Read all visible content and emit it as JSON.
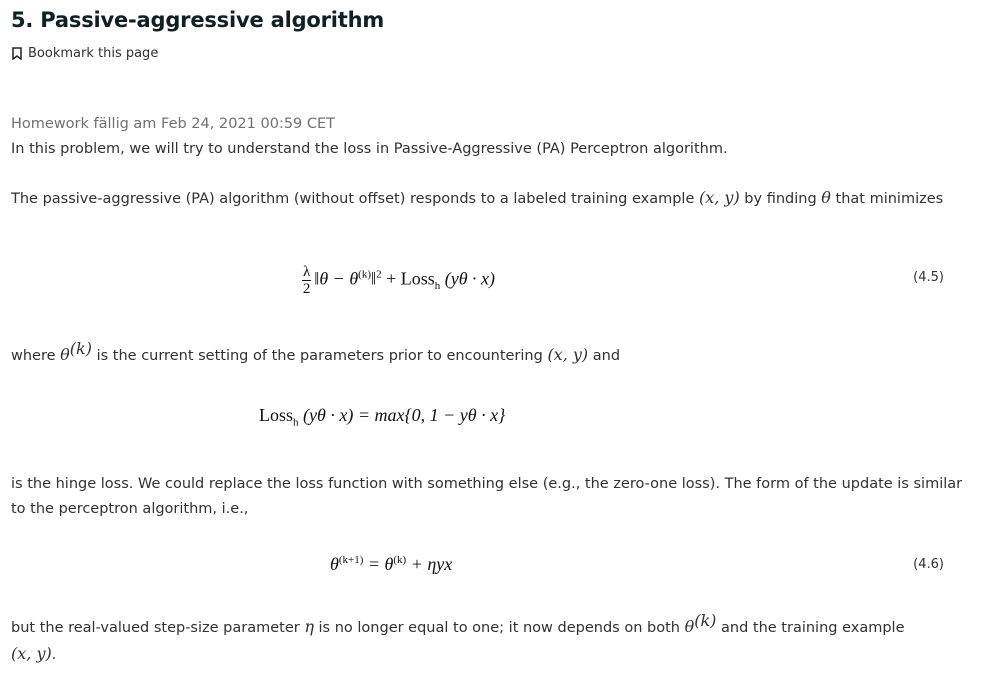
{
  "title": "5. Passive-aggressive algorithm",
  "bookmark": {
    "label": "Bookmark this page",
    "icon": "bookmark-icon"
  },
  "due": "Homework fällig am Feb 24, 2021 00:59 CET",
  "intro": "In this problem, we will try to understand the loss in Passive-Aggressive (PA) Perceptron algorithm.",
  "para1": {
    "a": "The passive-aggressive (PA) algorithm (without offset) responds to a labeled training example ",
    "xy": "(x, y)",
    "b": " by finding ",
    "theta": "θ",
    "c": " that minimizes"
  },
  "eq1": {
    "frac_num": "λ",
    "frac_den": "2",
    "body": "‖θ − θ",
    "sup_k": "(k)",
    "close": "‖",
    "sq": "2",
    "plus": " + Loss",
    "sub_h": "h",
    "arg": " (yθ · x)",
    "number": "(4.5)"
  },
  "para2": {
    "a": "where ",
    "theta": "θ",
    "sup_k": "(k)",
    "b": " is the current setting of the parameters prior to encountering ",
    "xy": "(x, y)",
    "c": " and"
  },
  "eq2": {
    "loss": "Loss",
    "sub_h": "h",
    "rest": " (yθ · x) = max{0, 1 − yθ · x}"
  },
  "para3": "is the hinge loss. We could replace the loss function with something else (e.g., the zero-one loss). The form of the update is similar to the perceptron algorithm, i.e.,",
  "eq3": {
    "theta": "θ",
    "sup_k1": "(k+1)",
    "eq": " = θ",
    "sup_k": "(k)",
    "rest": " + ηyx",
    "number": "(4.6)"
  },
  "para4": {
    "a": "but the real-valued step-size parameter ",
    "eta": "η",
    "b": " is no longer equal to one; it now depends on both ",
    "theta": "θ",
    "sup_k": "(k)",
    "c": " and the training example ",
    "xy": "(x, y)",
    "d": "."
  }
}
